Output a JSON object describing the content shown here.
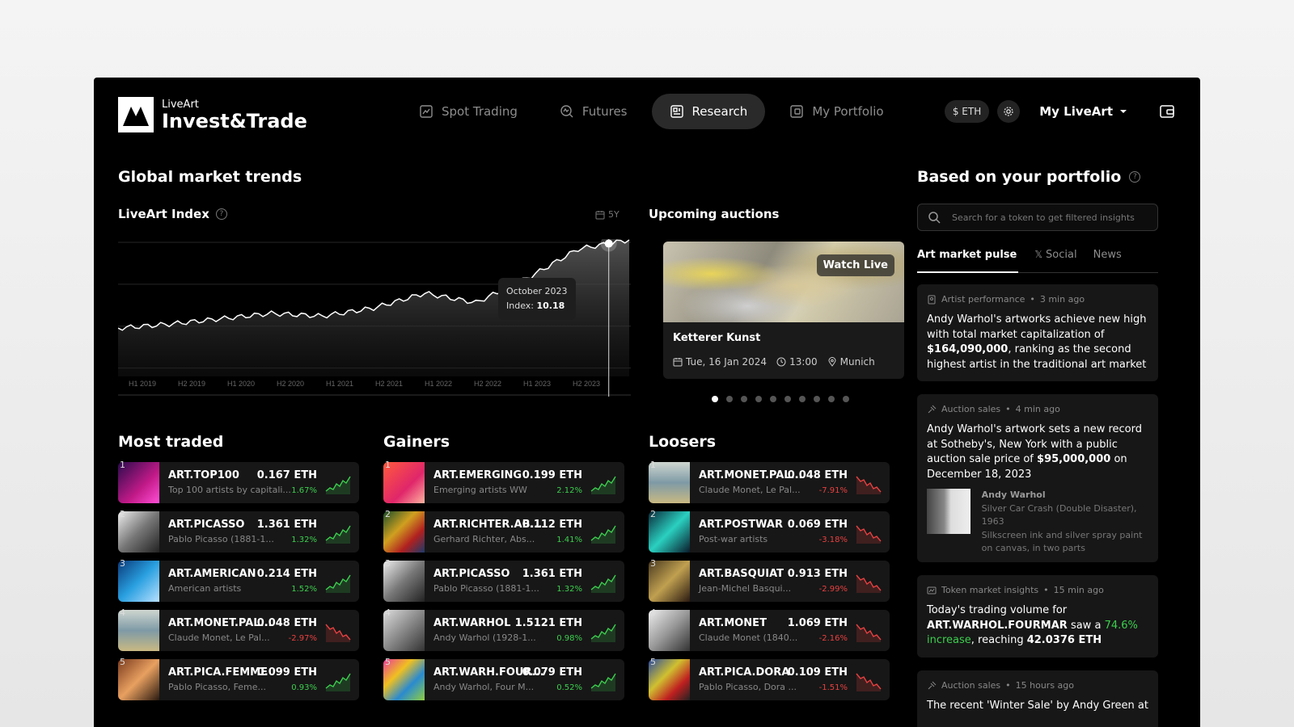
{
  "brand": {
    "small": "LiveArt",
    "big": "Invest&Trade"
  },
  "nav": [
    {
      "label": "Spot Trading",
      "icon": "chart-icon",
      "active": false
    },
    {
      "label": "Futures",
      "icon": "futures-icon",
      "active": false
    },
    {
      "label": "Research",
      "icon": "research-icon",
      "active": true
    },
    {
      "label": "My Portfolio",
      "icon": "portfolio-icon",
      "active": false
    }
  ],
  "header": {
    "currency": "$ ETH",
    "account": "My LiveArt"
  },
  "trends": {
    "title": "Global market trends",
    "index_title": "LiveArt Index",
    "range": "5Y",
    "tooltip": {
      "date": "October 2023",
      "label": "Index:",
      "value": "10.18"
    }
  },
  "chart_data": {
    "type": "area",
    "title": "LiveArt Index",
    "x": [
      "H1 2019",
      "H2 2019",
      "H1 2020",
      "H2 2020",
      "H1 2021",
      "H2 2021",
      "H1 2022",
      "H2 2022",
      "H1 2023",
      "H2 2023"
    ],
    "series": [
      {
        "values": [
          3.6,
          3.9,
          4.3,
          4.7,
          4.5,
          5.1,
          6.2,
          5.5,
          7.3,
          9.5
        ]
      }
    ],
    "highlight": {
      "x": "October 2023",
      "y": 10.18
    },
    "grid": true,
    "color": "#ffffff"
  },
  "auctions": {
    "title": "Upcoming auctions",
    "badge": "Watch Live",
    "name": "Ketterer Kunst",
    "date": "Tue, 16 Jan 2024",
    "time": "13:00",
    "location": "Munich",
    "dots": 10,
    "active_dot": 0
  },
  "most_traded": {
    "title": "Most traded",
    "rows": [
      {
        "rank": "1",
        "ticker": "ART.TOP100",
        "desc": "Top 100 artists by capitali...",
        "price": "0.167 ETH",
        "change": "1.67%",
        "dir": "up"
      },
      {
        "rank": "2",
        "ticker": "ART.PICASSO",
        "desc": "Pablo Picasso (1881-1...",
        "price": "1.361 ETH",
        "change": "1.32%",
        "dir": "up"
      },
      {
        "rank": "3",
        "ticker": "ART.AMERICAN",
        "desc": "American artists",
        "price": "0.214 ETH",
        "change": "1.52%",
        "dir": "up"
      },
      {
        "rank": "4",
        "ticker": "ART.MONET.PAL...",
        "desc": "Claude Monet, Le Pal...",
        "price": "0.048 ETH",
        "change": "-2.97%",
        "dir": "down"
      },
      {
        "rank": "5",
        "ticker": "ART.PICA.FEMME",
        "desc": "Pablo Picasso, Feme...",
        "price": "0.099 ETH",
        "change": "0.93%",
        "dir": "up"
      }
    ]
  },
  "gainers": {
    "title": "Gainers",
    "rows": [
      {
        "rank": "1",
        "ticker": "ART.EMERGING",
        "desc": "Emerging artists WW",
        "price": "0.199 ETH",
        "change": "2.12%",
        "dir": "up"
      },
      {
        "rank": "2",
        "ticker": "ART.RICHTER.AB...",
        "desc": "Gerhard Richter, Abs...",
        "price": "0.112 ETH",
        "change": "1.41%",
        "dir": "up"
      },
      {
        "rank": "3",
        "ticker": "ART.PICASSO",
        "desc": "Pablo Picasso (1881-1...",
        "price": "1.361 ETH",
        "change": "1.32%",
        "dir": "up"
      },
      {
        "rank": "4",
        "ticker": "ART.WARHOL",
        "desc": "Andy Warhol (1928-1...",
        "price": "1.5121 ETH",
        "change": "0.98%",
        "dir": "up"
      },
      {
        "rank": "5",
        "ticker": "ART.WARH.FOUR...",
        "desc": "Andy Warhol, Four M...",
        "price": "0.079 ETH",
        "change": "0.52%",
        "dir": "up"
      }
    ]
  },
  "losers": {
    "title": "Loosers",
    "rows": [
      {
        "rank": "1",
        "ticker": "ART.MONET.PAL...",
        "desc": "Claude Monet, Le Pal...",
        "price": "0.048 ETH",
        "change": "-7.91%",
        "dir": "down"
      },
      {
        "rank": "2",
        "ticker": "ART.POSTWAR",
        "desc": "Post-war artists",
        "price": "0.069 ETH",
        "change": "-3.18%",
        "dir": "down"
      },
      {
        "rank": "3",
        "ticker": "ART.BASQUIAT",
        "desc": "Jean-Michel Basqui...",
        "price": "0.913 ETH",
        "change": "-2.99%",
        "dir": "down"
      },
      {
        "rank": "4",
        "ticker": "ART.MONET",
        "desc": "Claude Monet (1840...",
        "price": "1.069 ETH",
        "change": "-2.16%",
        "dir": "down"
      },
      {
        "rank": "5",
        "ticker": "ART.PICA.DORA",
        "desc": "Pablo Picasso, Dora ...",
        "price": "0.109 ETH",
        "change": "-1.51%",
        "dir": "down"
      }
    ]
  },
  "portfolio": {
    "title": "Based on your portfolio",
    "search_placeholder": "Search for a token to get filtered insights",
    "tabs": [
      "Art market pulse",
      "Social",
      "News"
    ],
    "insights": [
      {
        "category": "Artist performance",
        "time": "3 min ago"
      },
      {
        "category": "Auction sales",
        "time": "4 min ago"
      },
      {
        "category": "Token market insights",
        "time": "15 min ago"
      },
      {
        "category": "Auction sales",
        "time": "15 hours ago",
        "text": "The recent 'Winter Sale' by Andy Green at"
      }
    ],
    "i1": {
      "a": "Andy Warhol's artworks achieve new high with total market capitalization of ",
      "b": "$164,090,000",
      "c": ", ranking as the second highest artist in the traditional art market"
    },
    "i2": {
      "a": "Andy Warhol's artwork sets a new record at Sotheby's, New York with a public auction sale price of ",
      "b": "$95,000,000",
      "c": " on December 18, 2023",
      "art_name": "Andy Warhol",
      "art_title": "Silver Car Crash (Double Disaster), 1963",
      "art_medium": "Silkscreen ink and silver spray paint on canvas, in two parts"
    },
    "i3": {
      "a": "Today's trading volume for ",
      "b": "ART.WARHOL.FOURMAR",
      "c": " saw a ",
      "g": "74.6% increase",
      "d": ", reaching ",
      "e": "42.0376 ETH"
    }
  }
}
